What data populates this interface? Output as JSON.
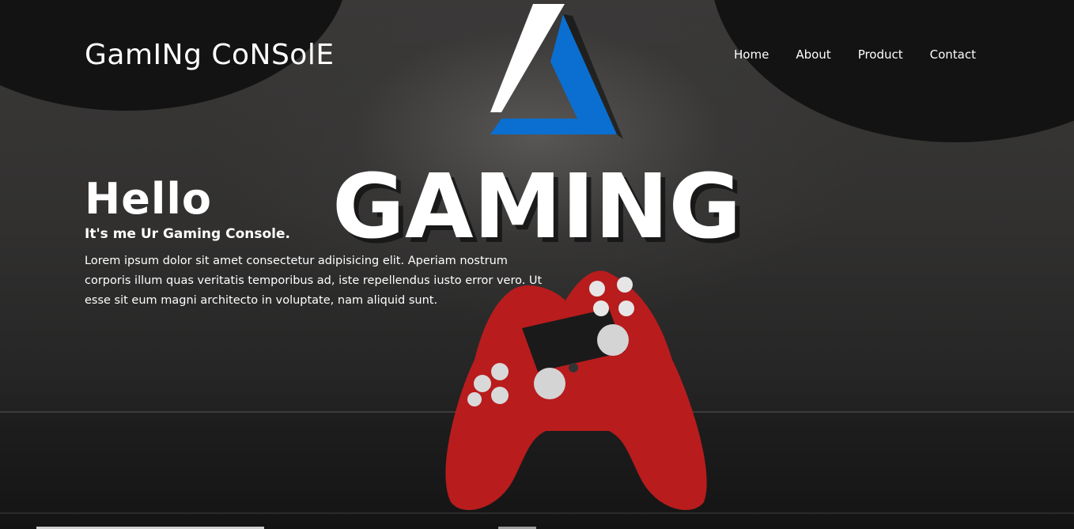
{
  "header": {
    "brand": "GamINg CoNSolE",
    "nav": [
      {
        "label": "Home"
      },
      {
        "label": "About"
      },
      {
        "label": "Product"
      },
      {
        "label": "Contact"
      }
    ]
  },
  "hero": {
    "heading": "Hello",
    "subheading": "It's me Ur Gaming Console.",
    "body": "Lorem ipsum dolor sit amet consectetur adipisicing elit. Aperiam nostrum corporis illum quas veritatis temporibus ad, iste repellendus iusto error vero. Ut esse sit eum magni architecto in voluptate, nam aliquid sunt."
  },
  "background_image": {
    "sign_word": "GAMING"
  },
  "colors": {
    "accent_blue": "#0a6fd0",
    "controller_red": "#c8201f",
    "text": "#ffffff"
  }
}
